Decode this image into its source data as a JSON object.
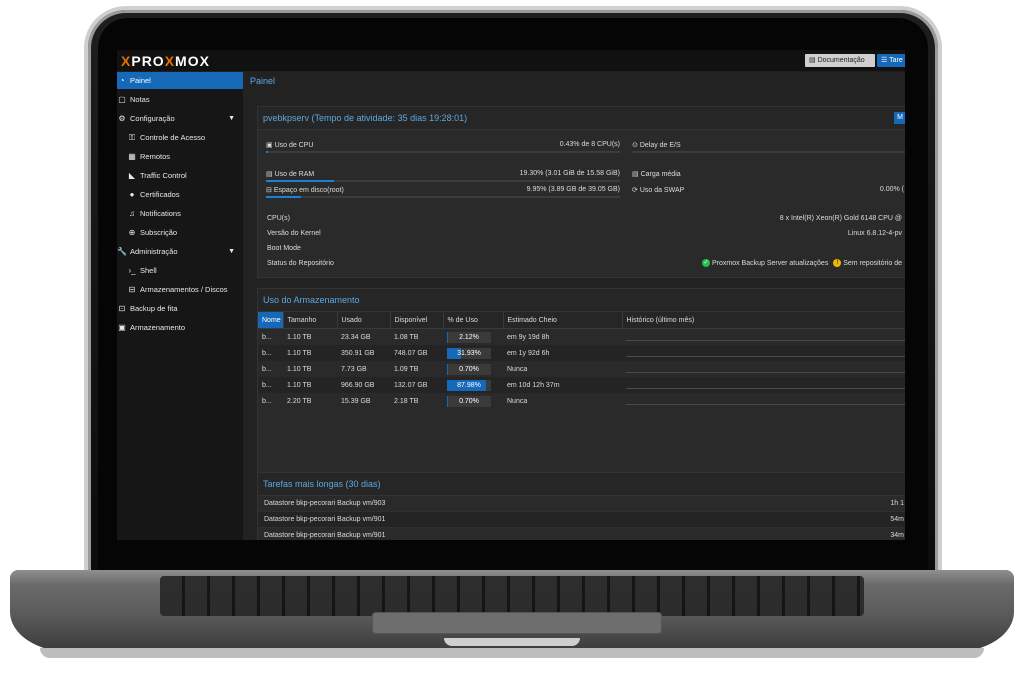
{
  "header": {
    "brand_prefix": "P",
    "brand_mid": "RO",
    "brand_x": "X",
    "brand_suffix": "MOX",
    "doc_button": "Documentação",
    "tasks_button": "Tare"
  },
  "sidebar": {
    "items": [
      {
        "label": "Painel",
        "icon": "dashboard-icon"
      },
      {
        "label": "Notas",
        "icon": "notes-icon"
      },
      {
        "label": "Configuração",
        "icon": "gears-icon"
      },
      {
        "label": "Controle de Acesso",
        "icon": "key-icon"
      },
      {
        "label": "Remotos",
        "icon": "server-icon"
      },
      {
        "label": "Traffic Control",
        "icon": "signal-icon"
      },
      {
        "label": "Certificados",
        "icon": "certificate-icon"
      },
      {
        "label": "Notifications",
        "icon": "bell-icon"
      },
      {
        "label": "Subscrição",
        "icon": "support-icon"
      },
      {
        "label": "Administração",
        "icon": "wrench-icon"
      },
      {
        "label": "Shell",
        "icon": "terminal-icon"
      },
      {
        "label": "Armazenamentos / Discos",
        "icon": "hdd-icon"
      },
      {
        "label": "Backup de fita",
        "icon": "tape-icon"
      },
      {
        "label": "Armazenamento",
        "icon": "database-icon"
      }
    ]
  },
  "main": {
    "breadcrumb": "Painel",
    "server_panel": {
      "title": "pvebkpserv (Tempo de atividade: 35 dias 19:28:01)",
      "more_button": "M",
      "cpu_label": "Uso de CPU",
      "cpu_value": "0.43% de 8 CPU(s)",
      "cpu_fraction": 0.0043,
      "io_label": "Delay de E/S",
      "ram_label": "Uso de RAM",
      "ram_value": "19.30% (3.01 GiB de 15.58 GiB)",
      "ram_fraction": 0.193,
      "load_label": "Carga média",
      "disk_label": "Espaço em disco(root)",
      "disk_value": "9.95% (3.89 GB de 39.05 GB)",
      "disk_fraction": 0.0995,
      "swap_label": "Uso da SWAP",
      "swap_value": "0.00% (",
      "cpus_label": "CPU(s)",
      "cpus_value": "8 x Intel(R) Xeon(R) Gold 6148 CPU @",
      "kernel_label": "Versão do Kernel",
      "kernel_value": "Linux 6.8.12-4-pv",
      "boot_label": "Boot Mode",
      "repo_label": "Status do Repositório",
      "repo_ok": "Proxmox Backup Server atualizações",
      "repo_warn": "Sem repositório de"
    },
    "storage_panel": {
      "title": "Uso do Armazenamento",
      "columns": [
        "Nome",
        "Tamanho",
        "Usado",
        "Disponível",
        "% de Uso",
        "Estimado Cheio",
        "Histórico (último mês)"
      ],
      "rows": [
        {
          "name": "b...",
          "size": "1.10 TB",
          "used": "23.34 GB",
          "avail": "1.08 TB",
          "pct": "2.12%",
          "frac": 0.0212,
          "full": "em 9y 19d 8h"
        },
        {
          "name": "b...",
          "size": "1.10 TB",
          "used": "350.91 GB",
          "avail": "748.07 GB",
          "pct": "31.93%",
          "frac": 0.3193,
          "full": "em 1y 92d 6h"
        },
        {
          "name": "b...",
          "size": "1.10 TB",
          "used": "7.73 GB",
          "avail": "1.09 TB",
          "pct": "0.70%",
          "frac": 0.007,
          "full": "Nunca"
        },
        {
          "name": "b...",
          "size": "1.10 TB",
          "used": "966.90 GB",
          "avail": "132.07 GB",
          "pct": "87.98%",
          "frac": 0.8798,
          "full": "em 10d 12h 37m"
        },
        {
          "name": "b...",
          "size": "2.20 TB",
          "used": "15.39 GB",
          "avail": "2.18 TB",
          "pct": "0.70%",
          "frac": 0.007,
          "full": "Nunca"
        }
      ]
    },
    "tasks_panel": {
      "title": "Tarefas mais longas (30 dias)",
      "rows": [
        {
          "label": "Datastore bkp-pecorari Backup vm/903",
          "duration": "1h 1"
        },
        {
          "label": "Datastore bkp-pecorari Backup vm/901",
          "duration": "54m"
        },
        {
          "label": "Datastore bkp-pecorari Backup vm/901",
          "duration": "34m"
        }
      ]
    }
  }
}
